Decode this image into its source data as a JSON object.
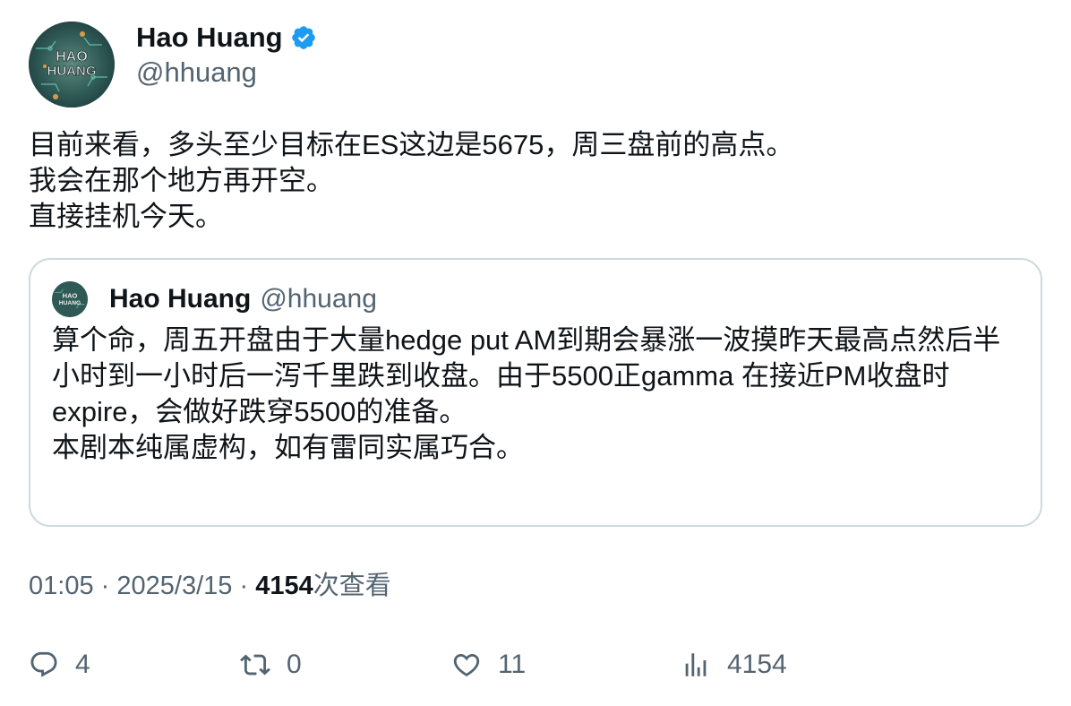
{
  "author": {
    "name": "Hao Huang",
    "handle": "@hhuang",
    "avatar_text_line1": "HAO",
    "avatar_text_line2": "HUANG",
    "verified_color": "#1d9bf0"
  },
  "tweet": {
    "text": "目前来看，多头至少目标在ES这边是5675，周三盘前的高点。\n我会在那个地方再开空。\n直接挂机今天。"
  },
  "quoted_tweet": {
    "name": "Hao Huang",
    "handle": "@hhuang",
    "text": "算个命，周五开盘由于大量hedge put AM到期会暴涨一波摸昨天最高点然后半小时到一小时后一泻千里跌到收盘。由于5500正gamma 在接近PM收盘时expire，会做好跌穿5500的准备。\n本剧本纯属虚构，如有雷同实属巧合。"
  },
  "meta": {
    "time": "01:05",
    "separator": "·",
    "date": "2025/3/15",
    "views_count": "4154",
    "views_label": "次查看"
  },
  "actions": {
    "reply_count": "4",
    "retweet_count": "0",
    "like_count": "11",
    "views_count": "4154"
  },
  "colors": {
    "text_primary": "#0f1419",
    "text_secondary": "#536471",
    "border": "#cfd9de",
    "accent": "#1d9bf0"
  },
  "icons": [
    "verified-badge-icon",
    "reply-icon",
    "retweet-icon",
    "like-icon",
    "views-icon"
  ]
}
